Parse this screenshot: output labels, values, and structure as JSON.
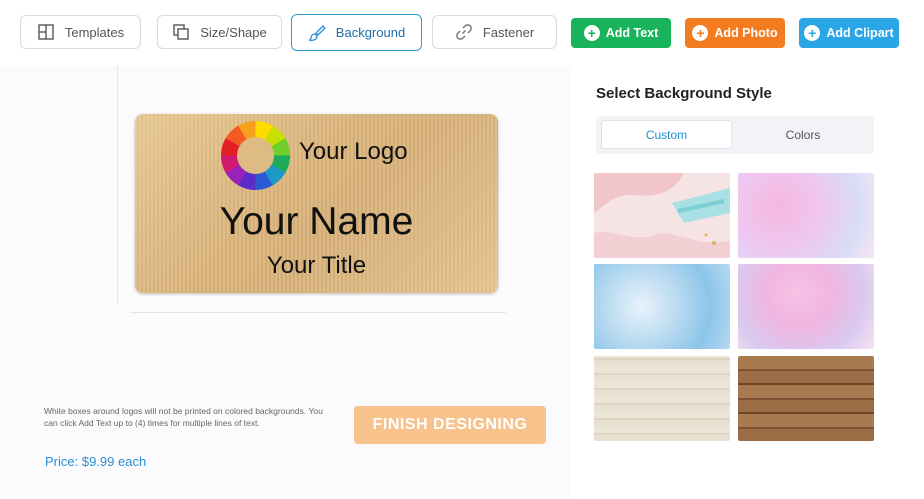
{
  "toolbar": {
    "tabs": [
      {
        "label": "Templates",
        "icon": "templates-icon"
      },
      {
        "label": "Size/Shape",
        "icon": "size-shape-icon"
      },
      {
        "label": "Background",
        "icon": "paint-brush-icon",
        "active": true
      },
      {
        "label": "Fastener",
        "icon": "link-icon"
      }
    ],
    "actions": [
      {
        "label": "Add Text",
        "color": "#18b35a"
      },
      {
        "label": "Add Photo",
        "color": "#f47c20"
      },
      {
        "label": "Add Clipart",
        "color": "#2aa6e6"
      }
    ]
  },
  "badge": {
    "logo_text": "Your Logo",
    "name_text": "Your Name",
    "title_text": "Your Title"
  },
  "note": "White boxes around logos will not be printed on colored backgrounds. You can click Add Text up to (4) times for multiple lines of text.",
  "price": "Price: $9.99 each",
  "finish_label": "FINISH DESIGNING",
  "panel": {
    "title": "Select Background Style",
    "tabs": [
      {
        "label": "Custom",
        "active": true
      },
      {
        "label": "Colors",
        "active": false
      }
    ],
    "backgrounds": [
      {
        "name": "pink-abstract-brush"
      },
      {
        "name": "pink-purple-watercolor"
      },
      {
        "name": "blue-watercolor"
      },
      {
        "name": "pink-blue-watercolor"
      },
      {
        "name": "light-wood"
      },
      {
        "name": "dark-wood"
      }
    ]
  },
  "colors": {
    "accent": "#2b9bd2",
    "price": "#2a8fd0",
    "finish_button": "#f8c28c"
  }
}
